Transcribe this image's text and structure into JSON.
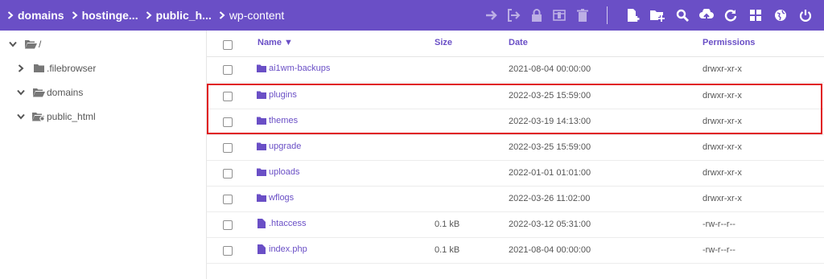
{
  "breadcrumbs": [
    "domains",
    "hostinge...",
    "public_h...",
    "wp-content"
  ],
  "toolbar": {
    "icons": [
      "arrow-right-icon",
      "move-icon",
      "lock-icon",
      "archive-icon",
      "trash-icon",
      "new-file-icon",
      "new-folder-icon",
      "search-icon",
      "upload-icon",
      "refresh-icon",
      "grid-view-icon",
      "globe-icon",
      "power-icon"
    ]
  },
  "tree": {
    "items": [
      {
        "label": "/",
        "icon": "folder-open-icon",
        "expanded": true
      },
      {
        "label": ".filebrowser",
        "icon": "folder-icon",
        "expanded": false
      },
      {
        "label": "domains",
        "icon": "folder-open-icon",
        "expanded": true
      },
      {
        "label": "public_html",
        "icon": "folder-link-icon",
        "expanded": true
      }
    ]
  },
  "table": {
    "headers": {
      "name": "Name ▼",
      "size": "Size",
      "date": "Date",
      "permissions": "Permissions"
    },
    "rows": [
      {
        "name": "ai1wm-backups",
        "type": "folder",
        "size": "",
        "date": "2021-08-04 00:00:00",
        "permissions": "drwxr-xr-x"
      },
      {
        "name": "plugins",
        "type": "folder",
        "size": "",
        "date": "2022-03-25 15:59:00",
        "permissions": "drwxr-xr-x"
      },
      {
        "name": "themes",
        "type": "folder",
        "size": "",
        "date": "2022-03-19 14:13:00",
        "permissions": "drwxr-xr-x"
      },
      {
        "name": "upgrade",
        "type": "folder",
        "size": "",
        "date": "2022-03-25 15:59:00",
        "permissions": "drwxr-xr-x"
      },
      {
        "name": "uploads",
        "type": "folder",
        "size": "",
        "date": "2022-01-01 01:01:00",
        "permissions": "drwxr-xr-x"
      },
      {
        "name": "wflogs",
        "type": "folder",
        "size": "",
        "date": "2022-03-26 11:02:00",
        "permissions": "drwxr-xr-x"
      },
      {
        "name": ".htaccess",
        "type": "file",
        "size": "0.1 kB",
        "date": "2022-03-12 05:31:00",
        "permissions": "-rw-r--r--"
      },
      {
        "name": "index.php",
        "type": "file",
        "size": "0.1 kB",
        "date": "2021-08-04 00:00:00",
        "permissions": "-rw-r--r--"
      }
    ]
  },
  "colors": {
    "accent": "#6a4fc6",
    "highlight": "#e0141c"
  }
}
